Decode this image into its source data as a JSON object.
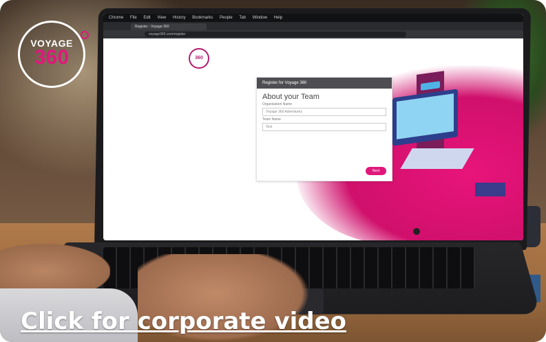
{
  "brand": {
    "logo_top": "VOYAGE",
    "logo_bottom": "360",
    "accent_color": "#e0187c"
  },
  "cta": {
    "label": "Click for corporate video"
  },
  "browser": {
    "menu_items": [
      "Chrome",
      "File",
      "Edit",
      "View",
      "History",
      "Bookmarks",
      "People",
      "Tab",
      "Window",
      "Help"
    ],
    "tab_title": "Register - Voyage 360",
    "url": "voyage360.com/register"
  },
  "form": {
    "header": "Register for Voyage 360",
    "title": "About your Team",
    "org_label": "Organisation Name",
    "org_value": "Voyage 360 Adventures",
    "team_label": "Team Name",
    "team_value": "Test",
    "submit_label": "Next"
  }
}
